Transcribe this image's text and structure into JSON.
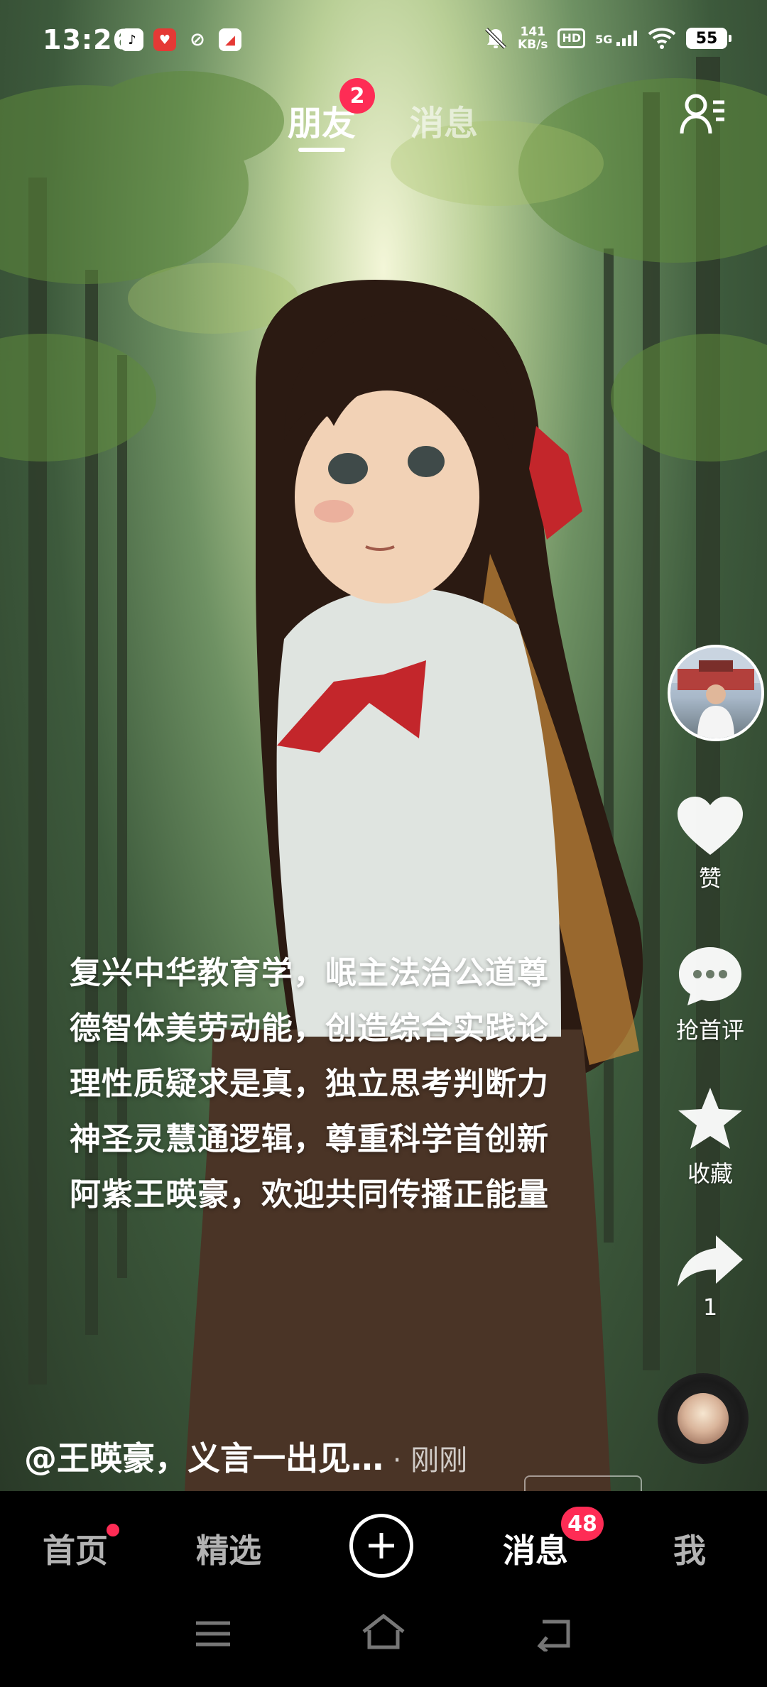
{
  "status_bar": {
    "time": "13:26",
    "net_speed_value": "141",
    "net_speed_unit": "KB/s",
    "hd_label": "HD",
    "network_label": "5G",
    "battery": "55"
  },
  "top_tabs": {
    "friends": "朋友",
    "friends_badge": "2",
    "messages": "消息"
  },
  "actions": {
    "like_label": "赞",
    "comment_label": "抢首评",
    "favorite_label": "收藏",
    "share_count": "1"
  },
  "poem": {
    "lines": [
      "复兴中华教育学，岷主法治公道尊",
      "德智体美劳动能，创造综合实践论",
      "理性质疑求是真，独立思考判断力",
      "神圣灵慧通逻辑，尊重科学首创新",
      "阿紫王暎豪，欢迎共同传播正能量"
    ]
  },
  "author": {
    "text": "@王暎豪，义言一出见…",
    "separator": " · ",
    "time": "刚刚"
  },
  "bottom_nav": {
    "home": "首页",
    "featured": "精选",
    "messages": "消息",
    "messages_badge": "48",
    "me": "我"
  },
  "colors": {
    "accent": "#fe2c55",
    "nav_bg": "#000000"
  }
}
